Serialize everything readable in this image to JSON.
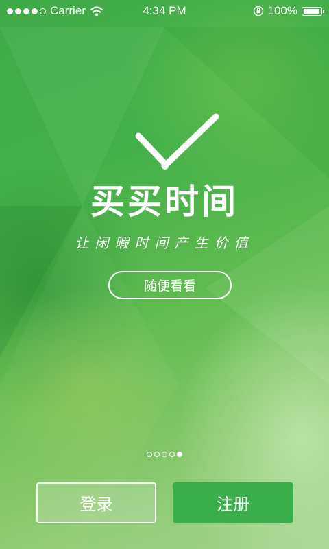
{
  "status_bar": {
    "carrier": "Carrier",
    "time": "4:34 PM",
    "battery_text": "100%",
    "battery_level": 1.0,
    "signal_bars_filled": 4,
    "signal_bars_total": 5,
    "icons": [
      "signal-icon",
      "wifi-icon",
      "rotation-lock-icon",
      "battery-icon"
    ]
  },
  "hero": {
    "logo_icon": "clock-checkmark-icon",
    "title": "买买时间",
    "slogan": "让闲暇时间产生价值",
    "browse_label": "随便看看"
  },
  "pager": {
    "total": 5,
    "active_index": 4
  },
  "actions": {
    "login_label": "登录",
    "register_label": "注册"
  },
  "colors": {
    "primary_green": "#3aae4a",
    "text": "#ffffff"
  }
}
